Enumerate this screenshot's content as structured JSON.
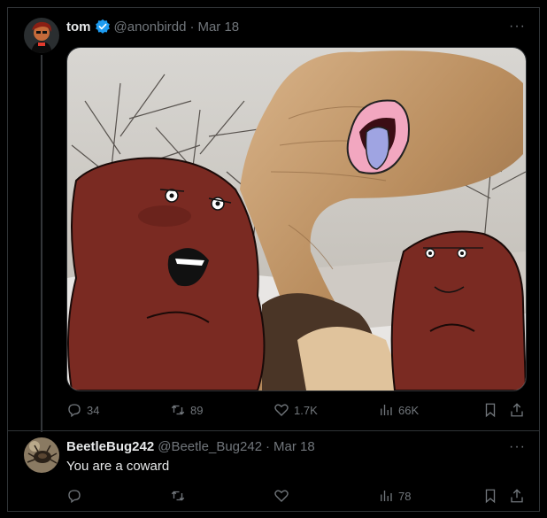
{
  "tweet": {
    "author_name": "tom",
    "handle": "@anonbirdd",
    "separator": "·",
    "date": "Mar 18",
    "more_label": "···",
    "stats": {
      "replies": "34",
      "reposts": "89",
      "likes": "1.7K",
      "views": "66K"
    }
  },
  "reply": {
    "author_name": "BeetleBug242",
    "handle": "@Beetle_Bug242",
    "separator": "·",
    "date": "Mar 18",
    "more_label": "···",
    "text": "You are a coward",
    "stats": {
      "replies": "",
      "reposts": "",
      "likes": "",
      "views": "78"
    }
  },
  "colors": {
    "background": "#000000",
    "muted": "#71767b",
    "text": "#e7e9ea",
    "verified": "#1d9bf0",
    "beaver_fur": "#7a2a22"
  },
  "icons": [
    "reply-icon",
    "repost-icon",
    "like-icon",
    "views-icon",
    "bookmark-icon",
    "share-icon",
    "verified-badge-icon",
    "more-icon"
  ]
}
